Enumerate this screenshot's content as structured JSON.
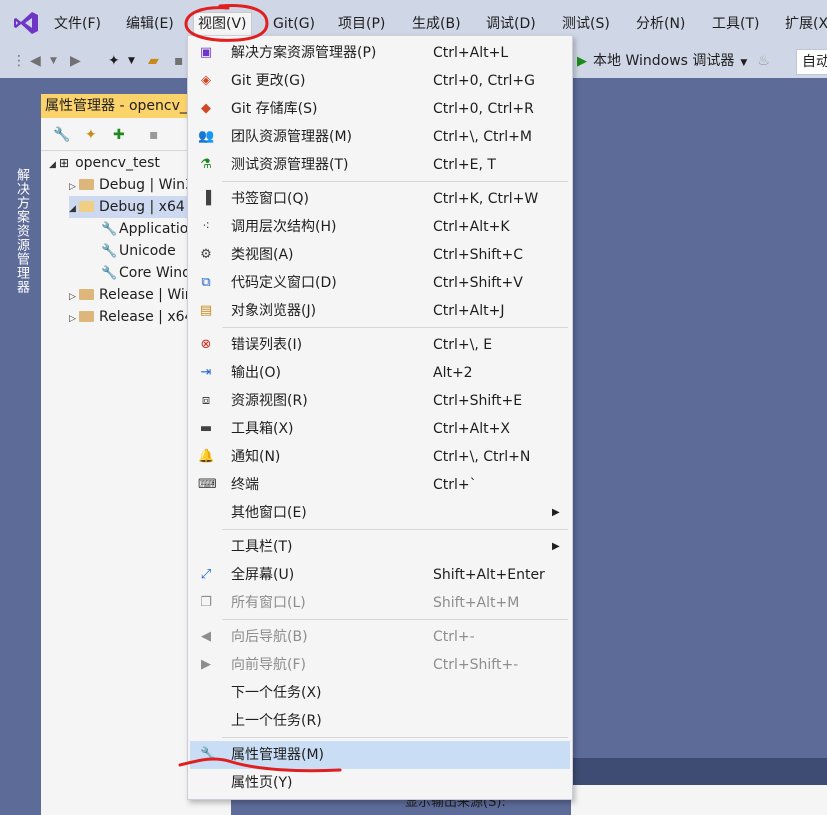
{
  "menubar": {
    "logo": "vs-logo",
    "items": [
      "文件(F)",
      "编辑(E)",
      "视图(V)",
      "Git(G)",
      "项目(P)",
      "生成(B)",
      "调试(D)",
      "测试(S)",
      "分析(N)",
      "工具(T)",
      "扩展(X"
    ]
  },
  "toolbar": {
    "run_label": "本地 Windows 调试器",
    "auto_label": "自动"
  },
  "side_tab": "解决方案资源管理器",
  "panel": {
    "title": "属性管理器 - opencv_test",
    "tree": [
      {
        "label": "opencv_test"
      },
      {
        "label": "Debug | Win32"
      },
      {
        "label": "Debug | x64"
      },
      {
        "label": "Application"
      },
      {
        "label": "Unicode"
      },
      {
        "label": "Core Windows"
      },
      {
        "label": "Release | Win32"
      },
      {
        "label": "Release | x64"
      }
    ]
  },
  "output": {
    "source_label": "显示输出来源(S):"
  },
  "view_menu": {
    "items": [
      {
        "label": "解决方案资源管理器(P)",
        "shortcut": "Ctrl+Alt+L",
        "icon": "solution-explorer-icon"
      },
      {
        "label": "Git 更改(G)",
        "shortcut": "Ctrl+0, Ctrl+G",
        "icon": "git-changes-icon"
      },
      {
        "label": "Git 存储库(S)",
        "shortcut": "Ctrl+0, Ctrl+R",
        "icon": "git-repository-icon"
      },
      {
        "label": "团队资源管理器(M)",
        "shortcut": "Ctrl+\\, Ctrl+M",
        "icon": "team-explorer-icon"
      },
      {
        "label": "测试资源管理器(T)",
        "shortcut": "Ctrl+E, T",
        "icon": "test-explorer-icon"
      },
      {
        "label": "书签窗口(Q)",
        "shortcut": "Ctrl+K, Ctrl+W",
        "icon": "bookmark-icon"
      },
      {
        "label": "调用层次结构(H)",
        "shortcut": "Ctrl+Alt+K",
        "icon": "call-hierarchy-icon"
      },
      {
        "label": "类视图(A)",
        "shortcut": "Ctrl+Shift+C",
        "icon": "class-view-icon"
      },
      {
        "label": "代码定义窗口(D)",
        "shortcut": "Ctrl+Shift+V",
        "icon": "code-definition-icon"
      },
      {
        "label": "对象浏览器(J)",
        "shortcut": "Ctrl+Alt+J",
        "icon": "object-browser-icon"
      },
      {
        "label": "错误列表(I)",
        "shortcut": "Ctrl+\\, E",
        "icon": "error-list-icon"
      },
      {
        "label": "输出(O)",
        "shortcut": "Alt+2",
        "icon": "output-icon"
      },
      {
        "label": "资源视图(R)",
        "shortcut": "Ctrl+Shift+E",
        "icon": "resource-view-icon"
      },
      {
        "label": "工具箱(X)",
        "shortcut": "Ctrl+Alt+X",
        "icon": "toolbox-icon"
      },
      {
        "label": "通知(N)",
        "shortcut": "Ctrl+\\, Ctrl+N",
        "icon": "notification-bell-icon"
      },
      {
        "label": "终端",
        "shortcut": "Ctrl+`",
        "icon": "terminal-icon"
      },
      {
        "label": "其他窗口(E)",
        "shortcut": "",
        "icon": ""
      },
      {
        "label": "工具栏(T)",
        "shortcut": "",
        "icon": ""
      },
      {
        "label": "全屏幕(U)",
        "shortcut": "Shift+Alt+Enter",
        "icon": "fullscreen-icon"
      },
      {
        "label": "所有窗口(L)",
        "shortcut": "Shift+Alt+M",
        "icon": "all-windows-icon"
      },
      {
        "label": "向后导航(B)",
        "shortcut": "Ctrl+-",
        "icon": "navigate-back-icon"
      },
      {
        "label": "向前导航(F)",
        "shortcut": "Ctrl+Shift+-",
        "icon": "navigate-forward-icon"
      },
      {
        "label": "下一个任务(X)",
        "shortcut": "",
        "icon": ""
      },
      {
        "label": "上一个任务(R)",
        "shortcut": "",
        "icon": ""
      },
      {
        "label": "属性管理器(M)",
        "shortcut": "",
        "icon": "property-manager-wrench-icon"
      },
      {
        "label": "属性页(Y)",
        "shortcut": "",
        "icon": ""
      }
    ]
  },
  "colors": {
    "annotation": "#e02020",
    "highlight": "#c9def5",
    "panel_title": "#fcd36b"
  }
}
